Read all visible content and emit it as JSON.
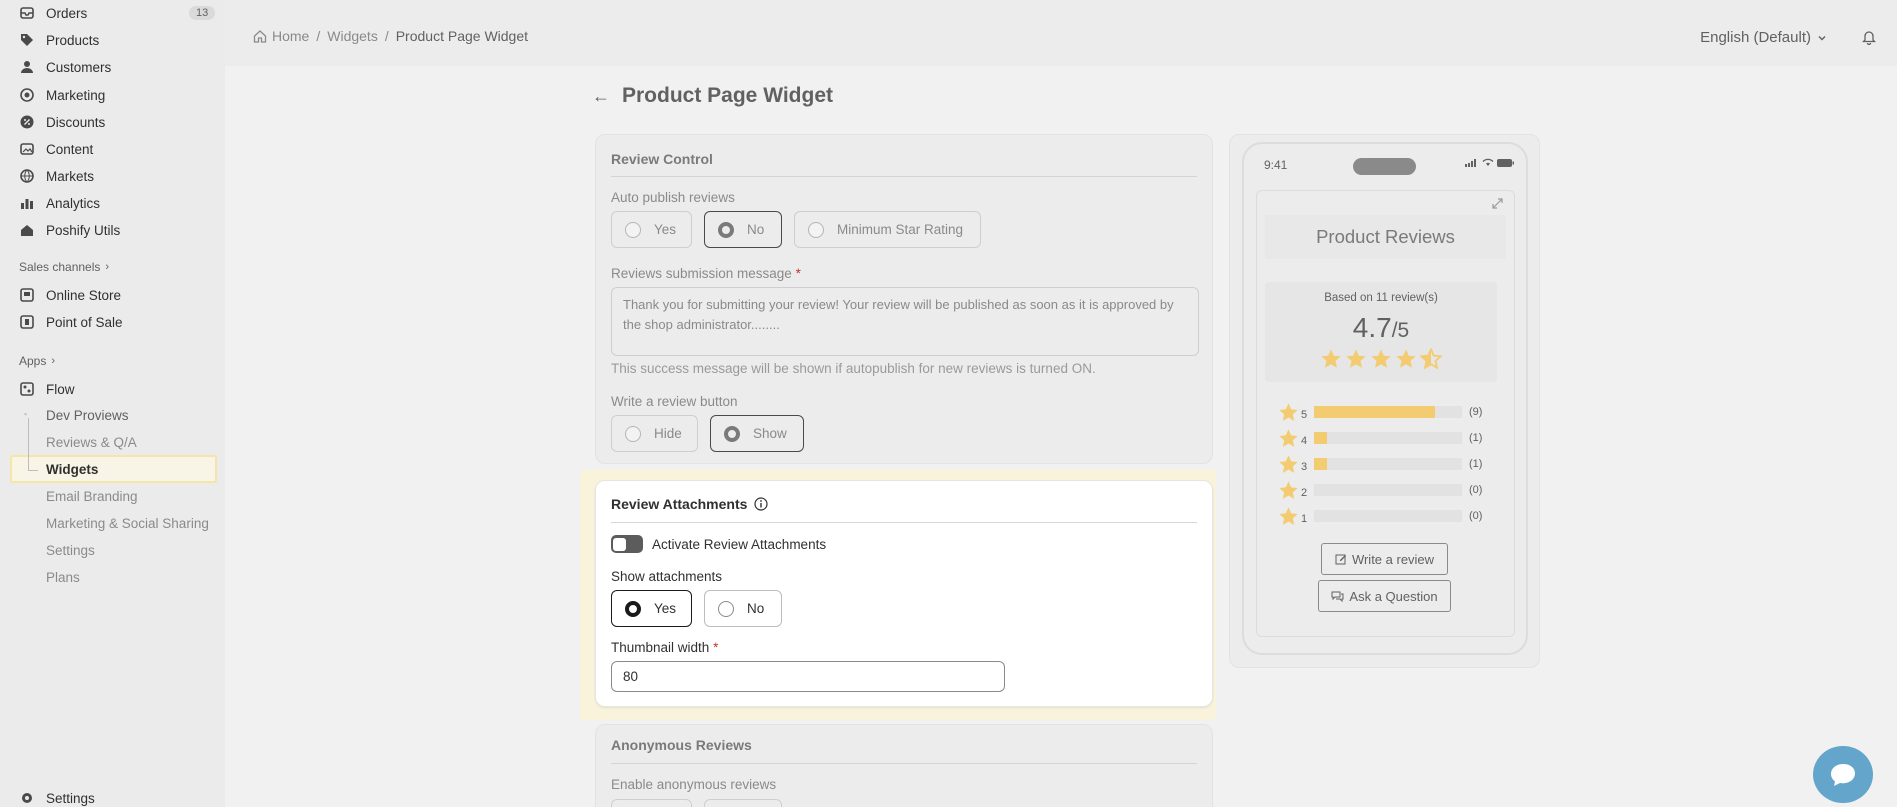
{
  "sidebar": {
    "items": [
      {
        "label": "Orders",
        "icon": "orders-icon",
        "badge": "13"
      },
      {
        "label": "Products",
        "icon": "tag-icon"
      },
      {
        "label": "Customers",
        "icon": "person-icon"
      },
      {
        "label": "Marketing",
        "icon": "target-icon"
      },
      {
        "label": "Discounts",
        "icon": "discount-icon"
      },
      {
        "label": "Content",
        "icon": "content-icon"
      },
      {
        "label": "Markets",
        "icon": "globe-icon"
      },
      {
        "label": "Analytics",
        "icon": "bar-chart-icon"
      },
      {
        "label": "Poshify Utils",
        "icon": "home-icon"
      }
    ],
    "sales_channels_header": "Sales channels",
    "sales_channels": [
      {
        "label": "Online Store",
        "icon": "store-icon"
      },
      {
        "label": "Point of Sale",
        "icon": "pos-icon"
      }
    ],
    "apps_header": "Apps",
    "apps": [
      {
        "label": "Flow",
        "icon": "flow-icon"
      }
    ],
    "app_subitems": [
      "Dev Proviews",
      "Reviews & Q/A",
      "Widgets",
      "Email Branding",
      "Marketing & Social Sharing",
      "Settings",
      "Plans"
    ],
    "settings_label": "Settings"
  },
  "topbar": {
    "breadcrumb": [
      "Home",
      "Widgets",
      "Product Page Widget"
    ],
    "language": "English (Default)"
  },
  "page": {
    "title": "Product Page Widget"
  },
  "review_control": {
    "title": "Review Control",
    "auto_publish_label": "Auto publish reviews",
    "auto_publish_options": [
      "Yes",
      "No",
      "Minimum Star Rating"
    ],
    "auto_publish_selected": "No",
    "submission_label": "Reviews submission message",
    "submission_required": "*",
    "submission_value": "Thank you for submitting your review! Your review will be published as soon as it is approved by the shop administrator........",
    "submission_help": "This success message will be shown if autopublish for new reviews is turned ON.",
    "write_button_label": "Write a review button",
    "write_button_options": [
      "Hide",
      "Show"
    ],
    "write_button_selected": "Show"
  },
  "review_attachments": {
    "title": "Review Attachments",
    "activate_label": "Activate Review Attachments",
    "activate_on": false,
    "show_label": "Show attachments",
    "show_options": [
      "Yes",
      "No"
    ],
    "show_selected": "Yes",
    "thumb_label": "Thumbnail width",
    "thumb_required": "*",
    "thumb_value": "80"
  },
  "anonymous_reviews": {
    "title": "Anonymous Reviews",
    "enable_label": "Enable anonymous reviews"
  },
  "preview": {
    "time": "9:41",
    "title": "Product Reviews",
    "based_on": "Based on 11 review(s)",
    "average": "4.7",
    "average_of": "/5",
    "average_value": 4.7,
    "distribution": [
      {
        "stars": "5",
        "count": "(9)",
        "fraction": 0.82
      },
      {
        "stars": "4",
        "count": "(1)",
        "fraction": 0.09
      },
      {
        "stars": "3",
        "count": "(1)",
        "fraction": 0.09
      },
      {
        "stars": "2",
        "count": "(0)",
        "fraction": 0
      },
      {
        "stars": "1",
        "count": "(0)",
        "fraction": 0
      }
    ],
    "write_review": "Write a review",
    "ask_question": "Ask a Question",
    "star_color": "#f3cb70"
  }
}
